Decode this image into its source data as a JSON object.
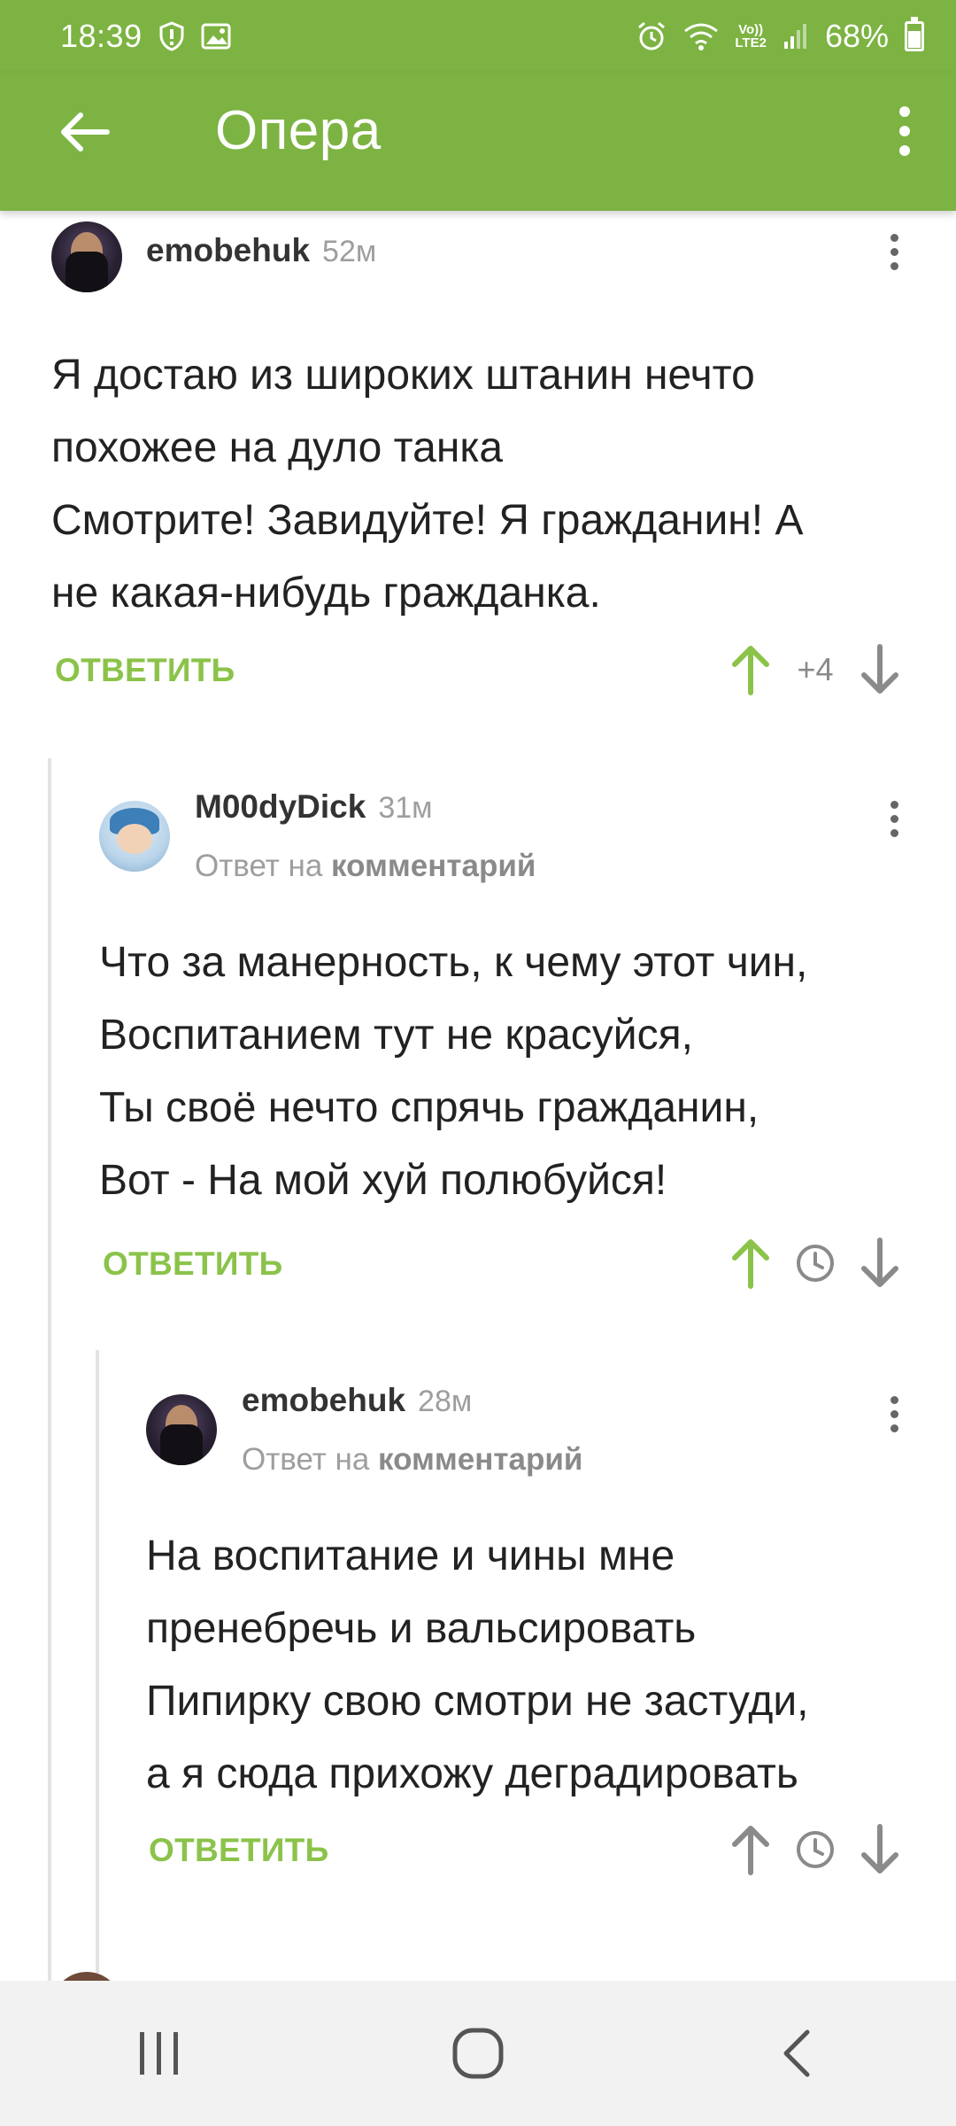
{
  "status_bar": {
    "time": "18:39",
    "battery": "68%",
    "network": "LTE2",
    "left_icons": [
      "shield-icon",
      "image-icon"
    ],
    "right_icons": [
      "alarm-icon",
      "wifi-icon",
      "volte-icon",
      "signal-icon",
      "battery-icon"
    ]
  },
  "app_bar": {
    "title": "Опера",
    "back_icon": "arrow-left-icon",
    "menu_icon": "overflow-menu-icon",
    "color": "#7cb342"
  },
  "comments": [
    {
      "username": "emobehuk",
      "time": "52м",
      "text": "Я достаю из широких штанин нечто\nпохожее на дуло танка\nСмотрите! Завидуйте! Я гражданин! А\nне какая-нибудь гражданка.",
      "reply_label": "ОТВЕТИТЬ",
      "score": "+4"
    },
    {
      "username": "M00dyDick",
      "time": "31м",
      "reply_to_prefix": "Ответ на",
      "reply_to_target": "комментарий",
      "text": "Что за манерность, к чему этот чин,\nВоспитанием тут не красуйся,\nТы своё нечто спрячь гражданин,\nВот - На мой хуй полюбуйся!",
      "reply_label": "ОТВЕТИТЬ"
    },
    {
      "username": "emobehuk",
      "time": "28м",
      "reply_to_prefix": "Ответ на",
      "reply_to_target": "комментарий",
      "text": "На воспитание и чины мне\nпренебречь и вальсировать\nПипирку свою смотри не застуди,\nа я сюда прихожу деградировать",
      "reply_label": "ОТВЕТИТЬ"
    }
  ],
  "colors": {
    "accent": "#7cb342",
    "reply_link": "#8bc34a",
    "upvote_active": "#8bc34a",
    "muted": "#9e9e9e"
  },
  "nav_bar": {
    "buttons": [
      "recent-apps-icon",
      "home-icon",
      "back-icon"
    ]
  }
}
